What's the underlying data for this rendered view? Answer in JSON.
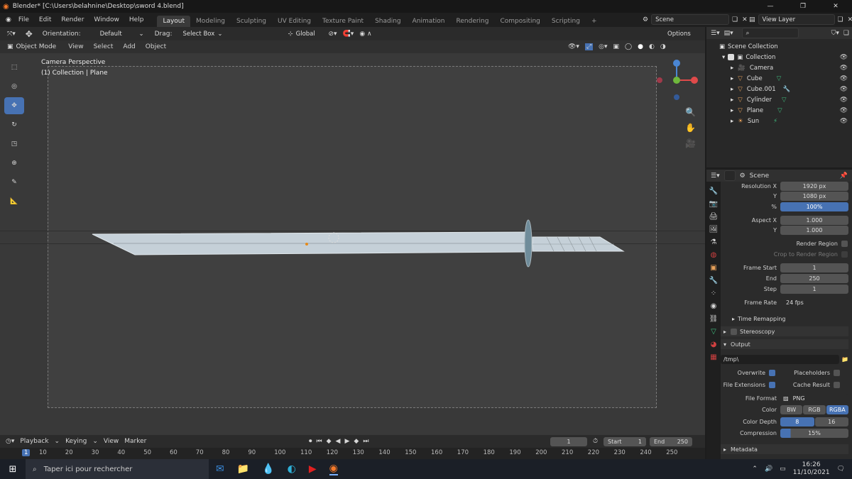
{
  "window": {
    "title": "Blender* [C:\\Users\\belahnine\\Desktop\\sword 4.blend]"
  },
  "menu": [
    "File",
    "Edit",
    "Render",
    "Window",
    "Help"
  ],
  "workspaces": [
    "Layout",
    "Modeling",
    "Sculpting",
    "UV Editing",
    "Texture Paint",
    "Shading",
    "Animation",
    "Rendering",
    "Compositing",
    "Scripting"
  ],
  "scene": "Scene",
  "view_layer": "View Layer",
  "tool_header": {
    "orientation_label": "Orientation:",
    "orientation": "Default",
    "drag_label": "Drag:",
    "drag": "Select Box",
    "transform": "Global",
    "options": "Options"
  },
  "view_header": {
    "mode": "Object Mode",
    "items": [
      "View",
      "Select",
      "Add",
      "Object"
    ]
  },
  "viewport": {
    "line1": "Camera Perspective",
    "line2": "(1) Collection | Plane"
  },
  "outliner": {
    "root": "Scene Collection",
    "collection": "Collection",
    "objects": [
      {
        "name": "Camera",
        "icon": "camera-icon"
      },
      {
        "name": "Cube",
        "icon": "mesh-icon"
      },
      {
        "name": "Cube.001",
        "icon": "mesh-icon"
      },
      {
        "name": "Cylinder",
        "icon": "mesh-icon"
      },
      {
        "name": "Plane",
        "icon": "mesh-icon"
      },
      {
        "name": "Sun",
        "icon": "light-icon"
      }
    ]
  },
  "properties": {
    "header": "Scene",
    "res_x_label": "Resolution X",
    "res_x": "1920 px",
    "res_y_label": "Y",
    "res_y": "1080 px",
    "pct_label": "%",
    "pct": "100%",
    "aspect_x_label": "Aspect X",
    "aspect_x": "1.000",
    "aspect_y_label": "Y",
    "aspect_y": "1.000",
    "render_region": "Render Region",
    "crop_region": "Crop to Render Region",
    "frame_start_label": "Frame Start",
    "frame_start": "1",
    "end_label": "End",
    "end": "250",
    "step_label": "Step",
    "step": "1",
    "frame_rate_label": "Frame Rate",
    "frame_rate": "24 fps",
    "time_remap": "Time Remapping",
    "stereoscopy": "Stereoscopy",
    "output": "Output",
    "path": "/tmp\\",
    "overwrite": "Overwrite",
    "placeholders": "Placeholders",
    "file_ext": "File Extensions",
    "cache_result": "Cache Result",
    "file_format_label": "File Format",
    "file_format": "PNG",
    "color_label": "Color",
    "color_opts": [
      "BW",
      "RGB",
      "RGBA"
    ],
    "depth_label": "Color Depth",
    "depth_opts": [
      "8",
      "16"
    ],
    "compression_label": "Compression",
    "compression": "15%",
    "metadata": "Metadata"
  },
  "timeline": {
    "menus": [
      "Playback",
      "Keying",
      "View",
      "Marker"
    ],
    "current_frame": "1",
    "start_label": "Start",
    "start": "1",
    "end_label": "End",
    "end": "250",
    "ticks": [
      "1",
      "10",
      "20",
      "30",
      "40",
      "50",
      "60",
      "70",
      "80",
      "90",
      "100",
      "110",
      "120",
      "130",
      "140",
      "150",
      "160",
      "170",
      "180",
      "190",
      "200",
      "210",
      "220",
      "230",
      "240",
      "250"
    ]
  },
  "taskbar": {
    "search": "Taper ici pour rechercher",
    "time": "16:26",
    "date": "11/10/2021"
  },
  "colors": {
    "accent": "#4772b3",
    "sword": "#c5d0d8"
  }
}
